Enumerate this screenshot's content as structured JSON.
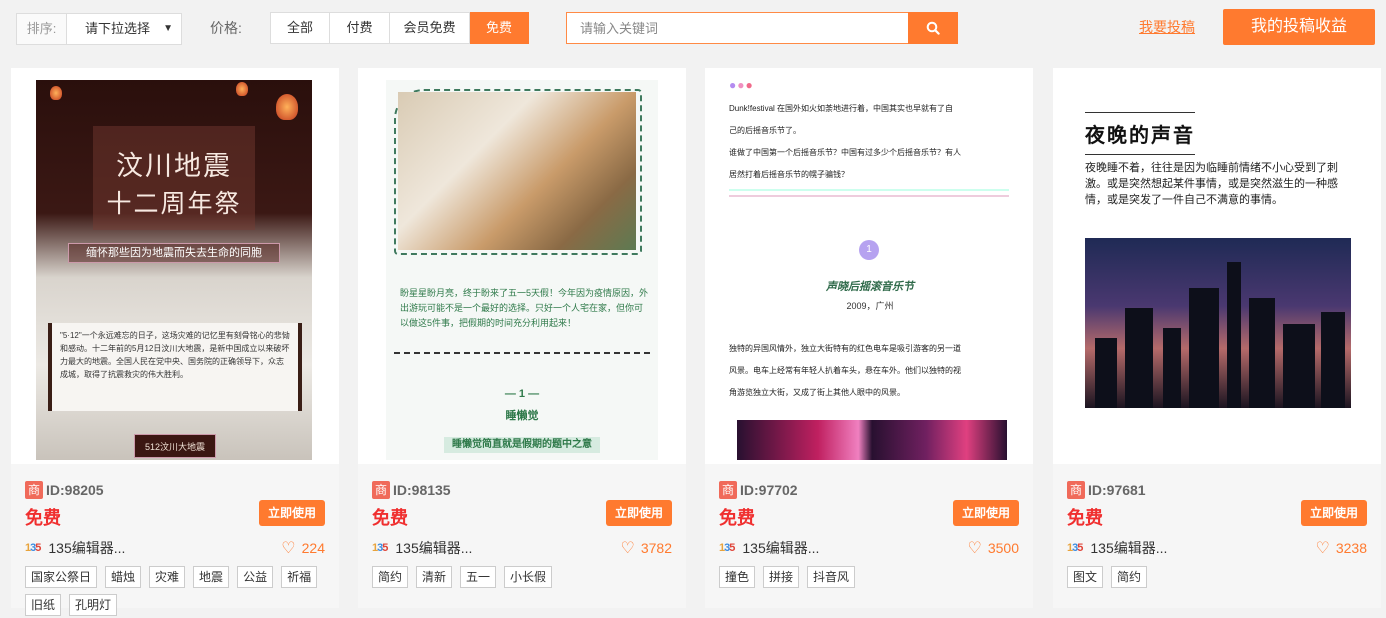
{
  "filters": {
    "sort_label": "排序:",
    "sort_value": "请下拉选择",
    "price_label": "价格:",
    "price_options": [
      "全部",
      "付费",
      "会员免费",
      "免费"
    ],
    "price_selected": "免费"
  },
  "search": {
    "placeholder": "请输入关键词",
    "icon": "search-icon"
  },
  "header_links": {
    "submit": "我要投稿",
    "earnings": "我的投稿收益"
  },
  "colors": {
    "accent": "#ff7a2f",
    "price": "#f02f2f",
    "badge": "#f06a5a"
  },
  "cards": [
    {
      "id": "ID:98205",
      "badge": "商",
      "price": "免费",
      "use": "立即使用",
      "author": "135编辑器...",
      "likes": "224",
      "tags": [
        "国家公祭日",
        "蜡烛",
        "灾难",
        "地震",
        "公益",
        "祈福",
        "旧纸",
        "孔明灯"
      ],
      "preview": {
        "title_line1": "汶川地震",
        "title_line2": "十二周年祭",
        "subtitle": "缅怀那些因为地震而失去生命的同胞",
        "paragraph": "\"5·12\"一个永远难忘的日子，这场灾难的记忆里有刻骨铭心的悲恸和感动。十二年前的5月12日汶川大地震，是新中国成立以来破坏力最大的地震。全国人民在党中央、国务院的正确领导下，众志成城，取得了抗震救灾的伟大胜利。",
        "footer": "512汶川大地震"
      }
    },
    {
      "id": "ID:98135",
      "badge": "商",
      "price": "免费",
      "use": "立即使用",
      "author": "135编辑器...",
      "likes": "3782",
      "tags": [
        "简约",
        "清新",
        "五一",
        "小长假"
      ],
      "preview": {
        "paragraph": "盼星星盼月亮，终于盼来了五一5天假！今年因为疫情原因，外出游玩可能不是一个最好的选择。只好一个人宅在家，但你可以做这5件事，把假期的时间充分利用起来！",
        "number": "— 1 —",
        "heading": "睡懒觉",
        "caption": "睡懒觉简直就是假期的题中之意"
      }
    },
    {
      "id": "ID:97702",
      "badge": "商",
      "price": "免费",
      "use": "立即使用",
      "author": "135编辑器...",
      "likes": "3500",
      "tags": [
        "撞色",
        "拼接",
        "抖音风"
      ],
      "preview": {
        "line1": "Dunk!festival 在国外如火如荼地进行着，中国其实也早就有了自",
        "line2": "己的后摇音乐节了。",
        "line3": "谁做了中国第一个后摇音乐节？中国有过多少个后摇音乐节？有人",
        "line4": "居然打着后摇音乐节的幌子骗钱？",
        "number": "1",
        "festival": "声晓后摇滚音乐节",
        "year": "2009，广州",
        "para1": "独特的异国风情外，独立大街特有的红色电车是吸引游客的另一道",
        "para2": "风景。电车上经常有年轻人扒着车头，悬在车外。他们以独特的视",
        "para3": "角游览独立大街，又成了街上其他人眼中的风景。"
      }
    },
    {
      "id": "ID:97681",
      "badge": "商",
      "price": "免费",
      "use": "立即使用",
      "author": "135编辑器...",
      "likes": "3238",
      "tags": [
        "图文",
        "简约"
      ],
      "preview": {
        "title": "夜晚的声音",
        "body": "夜晚睡不着，往往是因为临睡前情绪不小心受到了刺激。或是突然想起某件事情，或是突然滋生的一种感情，或是突发了一件自己不满意的事情。"
      }
    }
  ]
}
